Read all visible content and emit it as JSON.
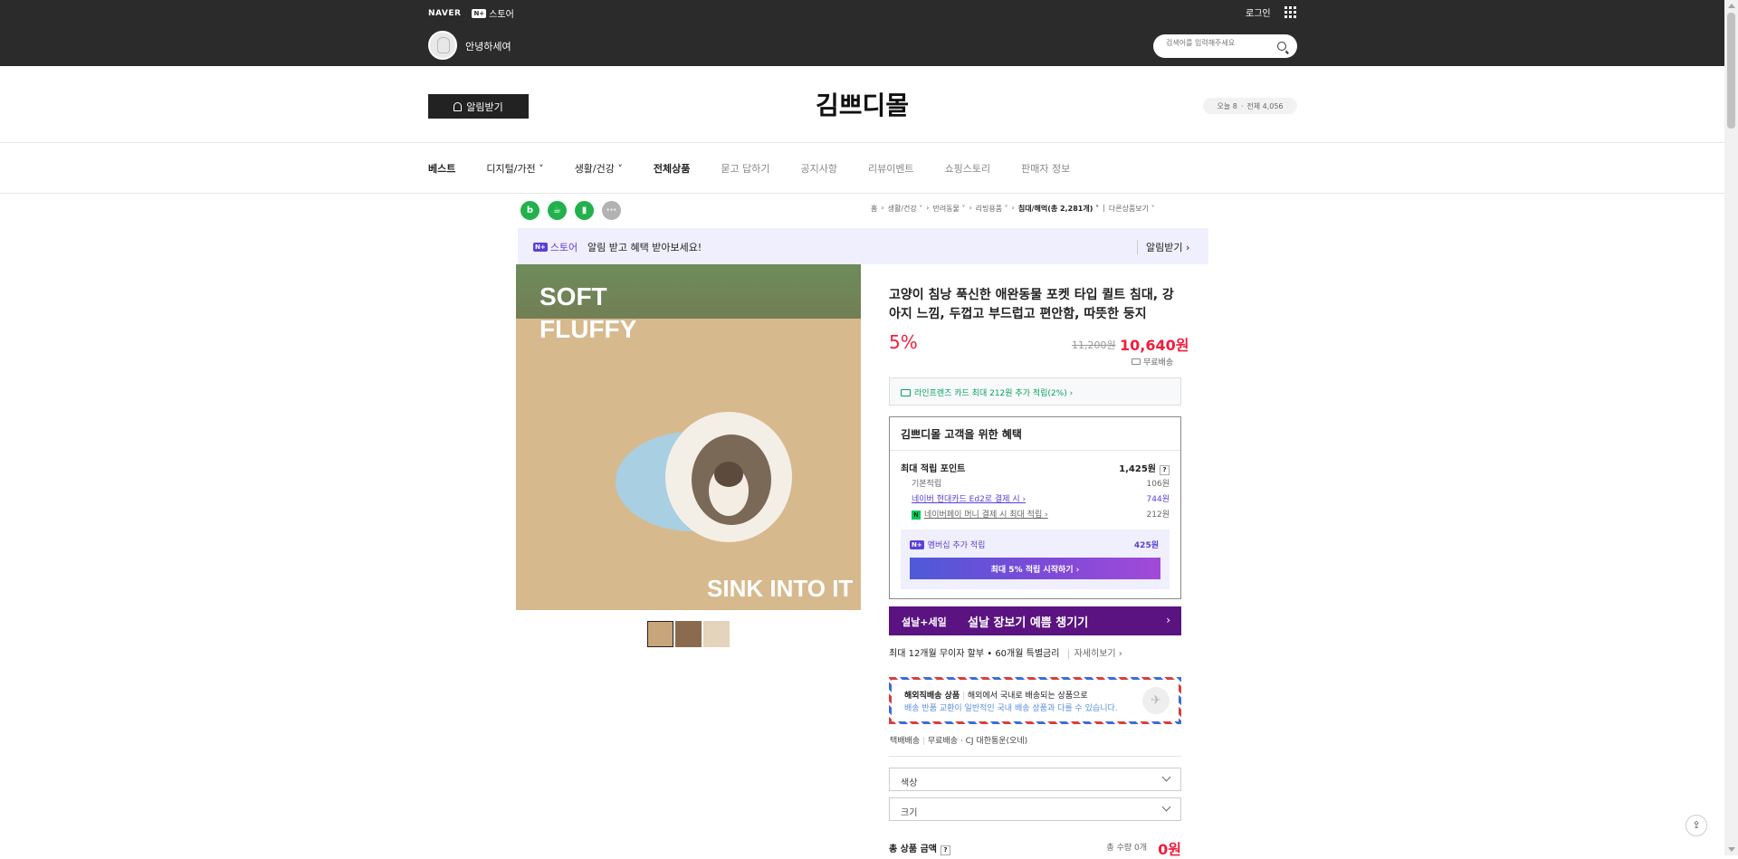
{
  "topbar": {
    "naver_logo": "NAVER",
    "np_badge": "N+",
    "store_label": "스토어",
    "login": "로그인",
    "greeting": "안녕하세여",
    "search_placeholder": "검색어를 입력해주세요"
  },
  "store": {
    "alarm_button": "알림받기",
    "title": "김쁘디몰",
    "visitors_today": "오늘 8",
    "visitors_total": "전체 4,056"
  },
  "nav": {
    "items": [
      "베스트",
      "디지털/가전",
      "생활/건강",
      "전체상품",
      "묻고 답하기",
      "공지사항",
      "리뷰이벤트",
      "쇼핑스토리",
      "판매자 정보"
    ]
  },
  "breadcrumb": [
    "홈",
    "생활/건강",
    "반려동물",
    "리빙용품",
    "침대/해먹(총 2,281개)",
    "다른상품보기"
  ],
  "promo": {
    "logo": "스토어",
    "badge": "N+",
    "text": "알림 받고 혜택 받아보세요!",
    "link": "알림받기 ›"
  },
  "image": {
    "text_top": [
      "SOFT",
      "FLUFFY"
    ],
    "text_bottom": "SINK INTO IT"
  },
  "product": {
    "name": "고양이 침낭 푹신한 애완동물 포켓 타입 퀼트 침대, 강아지 느낌, 두껍고 부드럽고 편안함, 따뜻한 둥지",
    "discount": "5%",
    "original_price": "11,200원",
    "sale_price": "10,640원",
    "shipping": "무료배송",
    "card_benefit": "라인프렌즈 카드 최대 212원 추가 적립(2%) ›"
  },
  "benefit": {
    "title": "김쁘디몰 고객을 위한 혜택",
    "rows": [
      {
        "label": "최대 적립 포인트",
        "value": "1,425원"
      },
      {
        "label": "기본적립",
        "value": "106원"
      },
      {
        "label": "네이버 현대카드 Ed2로 결제 시 ›",
        "value": "744원"
      },
      {
        "label": "네이버페이 머니 결제 시 최대 적립 ›",
        "value": "212원"
      }
    ],
    "member_label": "멤버십 추가 적립",
    "member_value": "425원",
    "member_button": "최대 5% 적립 시작하기 ›"
  },
  "sale_banner": {
    "tag": "설날+세일",
    "message": "설날 장보기 예쁨 챙기기",
    "chevron": "›"
  },
  "installment": {
    "text": "최대 12개월 무이자 할부 • 60개월 특별금리",
    "more": "자세히보기 ›"
  },
  "overseas": {
    "label": "해외직배송 상품",
    "line1": "해외에서 국내로 배송되는 상품으로",
    "line2": "배송 반품 교환이 일반적인 국내 배송 상품과 다를 수 있습니다."
  },
  "delivery": {
    "type": "택배배송",
    "fee": "무료배송",
    "courier": "CJ 대한통운(오네)"
  },
  "options": [
    {
      "label": "색상"
    },
    {
      "label": "크기"
    }
  ],
  "total": {
    "label": "총 상품 금액",
    "qty": "총 수량 0개",
    "amount": "0원"
  },
  "colors": {
    "accent_red": "#f01e3c",
    "naver_green": "#03c75a",
    "purple": "#5b3fd6",
    "sale_purple": "#5a1380"
  }
}
